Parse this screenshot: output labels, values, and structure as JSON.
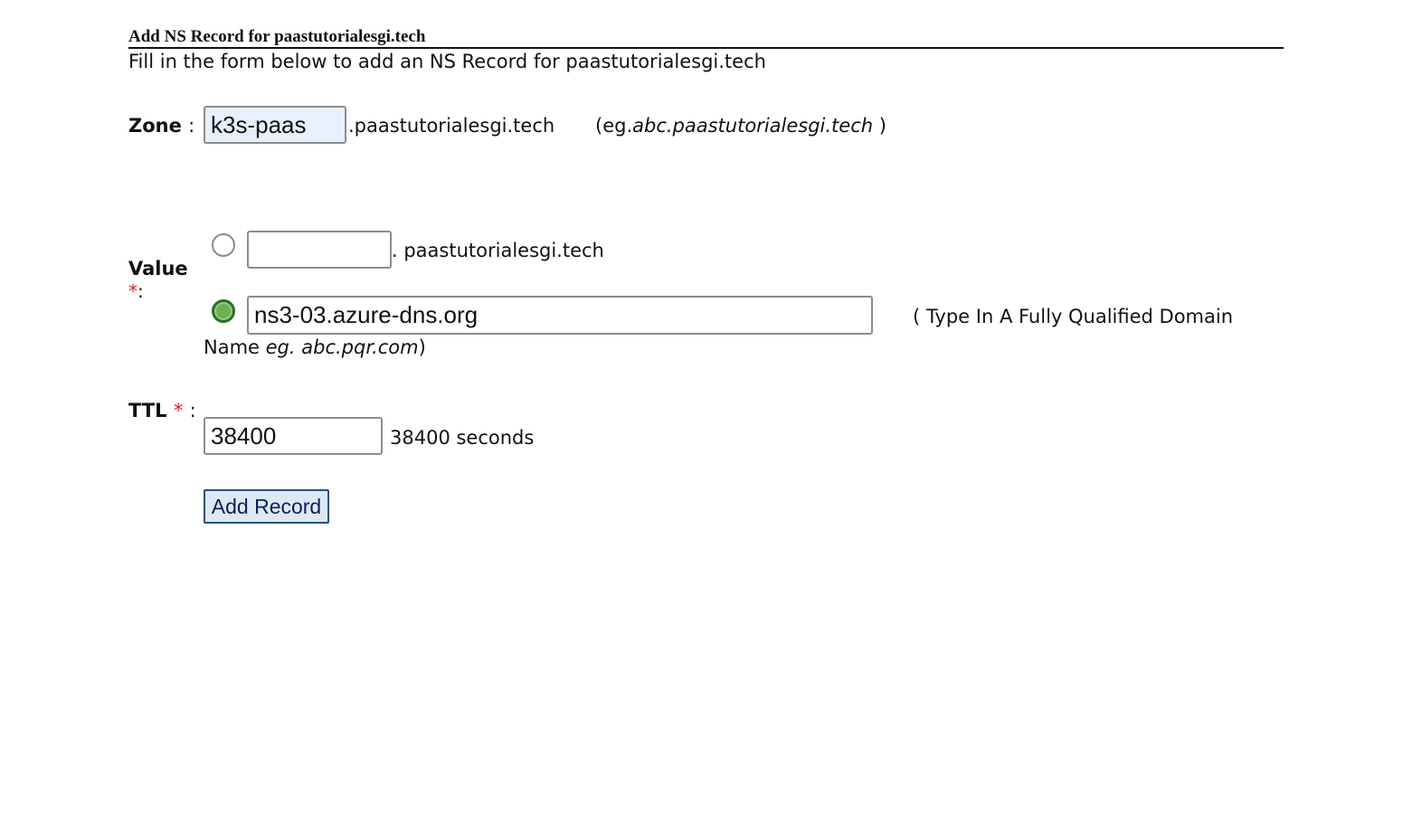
{
  "header": {
    "title": "Add NS Record for paastutorialesgi.tech",
    "subtitle": "Fill in the form below to add an NS Record for paastutorialesgi.tech"
  },
  "zone": {
    "label": "Zone",
    "colon": ":",
    "value": "k3s-paas",
    "suffix": ".paastutorialesgi.tech",
    "example_prefix": "(eg.",
    "example_italic": "abc.paastutorialesgi.tech",
    "example_suffix": " )"
  },
  "value": {
    "label": "Value",
    "required_mark": "*",
    "colon": ":",
    "option1": {
      "input_value": "",
      "suffix": ". paastutorialesgi.tech",
      "selected": false
    },
    "option2": {
      "input_value": "ns3-03.azure-dns.org",
      "hint": "( Type In A Fully Qualified Domain",
      "hint_wrap_prefix": "Name ",
      "hint_example_italic": "eg. abc.pqr.com",
      "hint_wrap_suffix": ")",
      "selected": true
    }
  },
  "ttl": {
    "label": "TTL",
    "required_mark": "*",
    "colon": ":",
    "value": "38400",
    "description": "38400 seconds"
  },
  "submit": {
    "label": "Add Record"
  },
  "colors": {
    "required": "#e21b1b",
    "autofill_bg": "#e8f0fe",
    "button_bg": "#dde8f3",
    "button_border": "#2b4f86",
    "radio_checked": "#6fae5a"
  }
}
